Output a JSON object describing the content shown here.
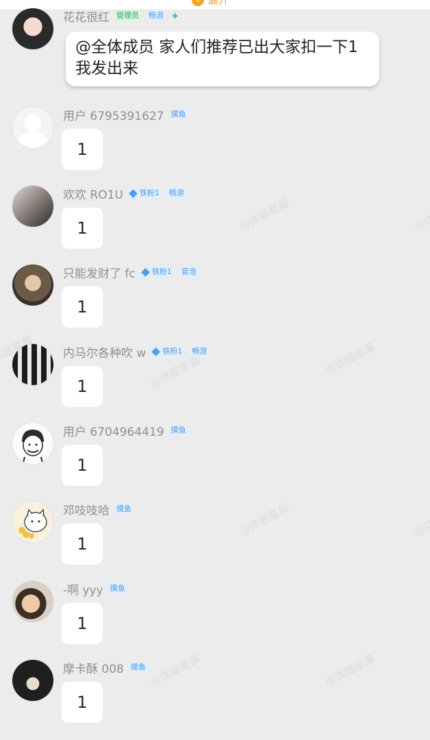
{
  "header": {
    "expand_label": "展开",
    "expand_icon": "chevron-down-icon"
  },
  "watermark": "@体圈星酱",
  "messages": [
    {
      "name": "花花很红",
      "badges": [
        "管理员",
        "畅游"
      ],
      "extra_icon": "bird-icon",
      "text": "@全体成员 家人们推荐已出大家扣一下1我发出来"
    },
    {
      "name": "用户 6795391627",
      "badges": [
        "摸鱼"
      ],
      "text": "1"
    },
    {
      "name": "欢欢 RO1U",
      "badges": [
        "铁粉1",
        "畅游"
      ],
      "text": "1"
    },
    {
      "name": "只能发财了 fc",
      "badges": [
        "铁粉1",
        "冒泡"
      ],
      "text": "1"
    },
    {
      "name": "内马尔各种吹 w",
      "badges": [
        "铁粉1",
        "畅游"
      ],
      "text": "1"
    },
    {
      "name": "用户 6704964419",
      "badges": [
        "摸鱼"
      ],
      "text": "1"
    },
    {
      "name": "邓吱吱哈",
      "badges": [
        "摸鱼"
      ],
      "text": "1"
    },
    {
      "name": "-啊 yyy",
      "badges": [
        "摸鱼"
      ],
      "text": "1"
    },
    {
      "name": "摩卡酥 008",
      "badges": [
        "摸鱼"
      ],
      "text": "1"
    }
  ]
}
